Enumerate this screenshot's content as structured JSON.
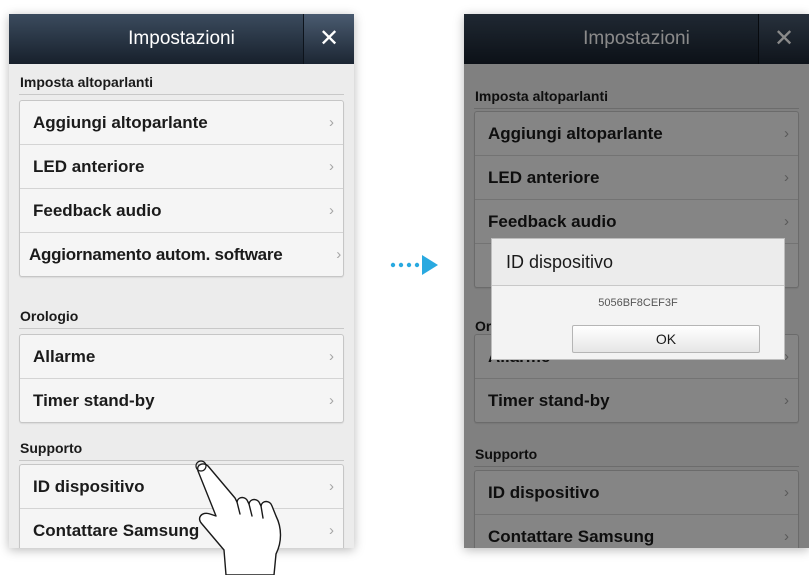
{
  "left_screen": {
    "title": "Impostazioni",
    "close_glyph": "✕",
    "sections": [
      {
        "header": "Imposta altoparlanti",
        "items": [
          {
            "label": "Aggiungi altoparlante"
          },
          {
            "label": "LED anteriore"
          },
          {
            "label": "Feedback audio"
          },
          {
            "label": "Aggiornamento autom. software"
          }
        ]
      },
      {
        "header": "Orologio",
        "items": [
          {
            "label": "Allarme"
          },
          {
            "label": "Timer stand-by"
          }
        ]
      },
      {
        "header": "Supporto",
        "items": [
          {
            "label": "ID dispositivo"
          },
          {
            "label": "Contattare Samsung"
          }
        ]
      }
    ],
    "chevron_glyph": "›"
  },
  "right_screen": {
    "title": "Impostazioni",
    "close_glyph": "✕",
    "sections": [
      {
        "header": "Imposta altoparlanti",
        "items": [
          {
            "label": "Aggiungi altoparlante"
          },
          {
            "label": "LED anteriore"
          },
          {
            "label": "Feedback audio"
          }
        ]
      },
      {
        "header": "Orologio",
        "items": [
          {
            "label": "Allarme"
          },
          {
            "label": "Timer stand-by"
          }
        ]
      },
      {
        "header": "Supporto",
        "items": [
          {
            "label": "ID dispositivo"
          },
          {
            "label": "Contattare Samsung"
          }
        ]
      }
    ],
    "dialog": {
      "title": "ID dispositivo",
      "value": "5056BF8CEF3F",
      "ok_label": "OK"
    },
    "chevron_glyph": "›"
  },
  "colors": {
    "accent_arrow": "#29a9e0",
    "titlebar": "#1e2835"
  },
  "icons": [
    "close-icon",
    "chevron-right-icon",
    "transition-arrow-icon",
    "tap-hand-icon"
  ]
}
